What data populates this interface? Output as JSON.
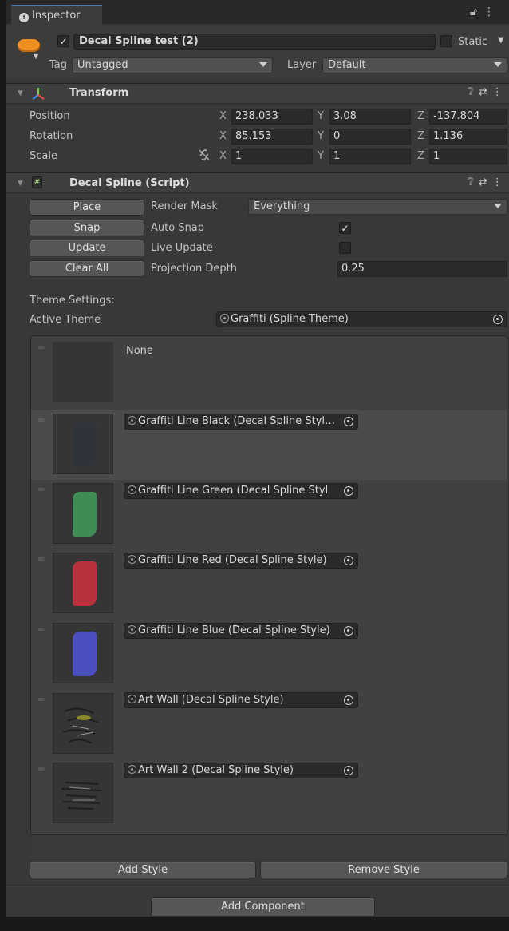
{
  "tab": {
    "label": "Inspector"
  },
  "header": {
    "object_name": "Decal Spline test (2)",
    "static_label": "Static",
    "tag_label": "Tag",
    "tag_value": "Untagged",
    "layer_label": "Layer",
    "layer_value": "Default"
  },
  "transform": {
    "title": "Transform",
    "position": {
      "label": "Position",
      "x": "238.033",
      "y": "3.08",
      "z": "-137.804"
    },
    "rotation": {
      "label": "Rotation",
      "x": "85.153",
      "y": "0",
      "z": "1.136"
    },
    "scale": {
      "label": "Scale",
      "x": "1",
      "y": "1",
      "z": "1"
    },
    "axis_x": "X",
    "axis_y": "Y",
    "axis_z": "Z"
  },
  "script": {
    "title": "Decal Spline (Script)",
    "buttons": {
      "place": "Place",
      "snap": "Snap",
      "update": "Update",
      "clear_all": "Clear All"
    },
    "render_mask_label": "Render Mask",
    "render_mask_value": "Everything",
    "auto_snap_label": "Auto Snap",
    "auto_snap_checked": true,
    "live_update_label": "Live Update",
    "live_update_checked": false,
    "projection_depth_label": "Projection Depth",
    "projection_depth_value": "0.25",
    "theme_settings_label": "Theme Settings:",
    "active_theme_label": "Active Theme",
    "active_theme_value": "Graffiti (Spline Theme)"
  },
  "styles": [
    {
      "name": "None",
      "swatch": ""
    },
    {
      "name": "Graffiti Line Black (Decal Spline Styl…",
      "swatch": "#2f343c"
    },
    {
      "name": "Graffiti Line Green (Decal Spline Styl",
      "swatch": "#3f8c55"
    },
    {
      "name": "Graffiti Line Red (Decal Spline Style)",
      "swatch": "#b8323c"
    },
    {
      "name": "Graffiti Line Blue (Decal Spline Style)",
      "swatch": "#4b4fc2"
    },
    {
      "name": "Art Wall (Decal Spline Style)",
      "swatch": "art"
    },
    {
      "name": "Art Wall 2 (Decal Spline Style)",
      "swatch": "art2"
    }
  ],
  "list_buttons": {
    "add_style": "Add Style",
    "remove_style": "Remove Style"
  },
  "add_component": "Add Component"
}
